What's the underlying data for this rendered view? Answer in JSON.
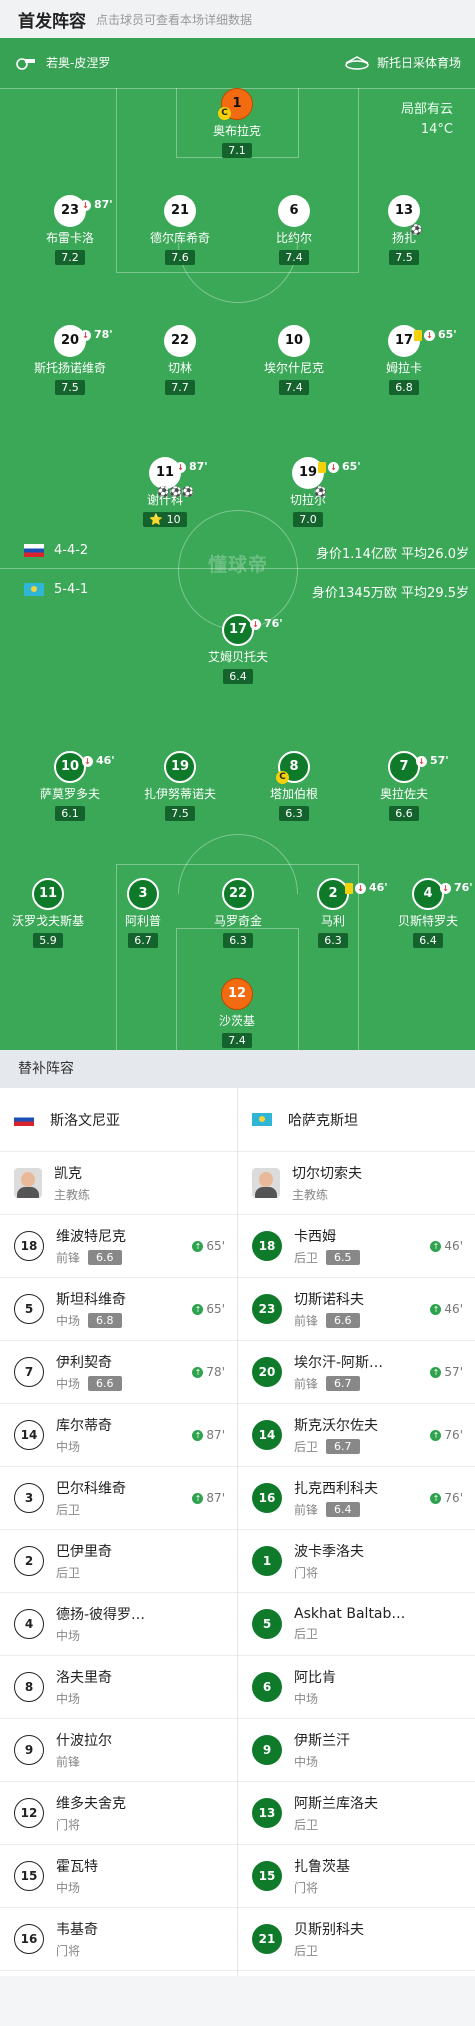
{
  "header": {
    "title": "首发阵容",
    "subtitle": "点击球员可查看本场详细数据"
  },
  "pitch": {
    "home_coach_label": "若奥-皮涅罗",
    "venue": "斯托日采体育场",
    "weather": "局部有云",
    "temperature": "14°C",
    "watermark": "懂球帝",
    "home_formation": "4-4-2",
    "away_formation": "5-4-1",
    "home_value": "身价1.14亿欧   平均26.0岁",
    "away_value": "身价1345万欧   平均29.5岁"
  },
  "home_players": [
    {
      "num": "1",
      "name": "奥布拉克",
      "rating": "7.1",
      "gk": true,
      "captain": true
    },
    {
      "num": "23",
      "name": "布雷卡洛",
      "rating": "7.2",
      "sub": "87'"
    },
    {
      "num": "21",
      "name": "德尔库希奇",
      "rating": "7.6"
    },
    {
      "num": "6",
      "name": "比约尔",
      "rating": "7.4"
    },
    {
      "num": "13",
      "name": "扬扎",
      "rating": "7.5"
    },
    {
      "num": "20",
      "name": "斯托扬诺维奇",
      "rating": "7.5",
      "sub": "78'"
    },
    {
      "num": "22",
      "name": "切林",
      "rating": "7.7"
    },
    {
      "num": "10",
      "name": "埃尔什尼克",
      "rating": "7.4"
    },
    {
      "num": "17",
      "name": "姆拉卡",
      "rating": "6.8",
      "sub": "65'",
      "yellow": true
    },
    {
      "num": "11",
      "name": "谢什科",
      "rating": "10",
      "sub": "87'"
    },
    {
      "num": "19",
      "name": "切拉尔",
      "rating": "7.0",
      "sub": "65'",
      "yellow": true
    }
  ],
  "away_players": [
    {
      "num": "17",
      "name": "艾姆贝托夫",
      "rating": "6.4",
      "sub": "76'"
    },
    {
      "num": "10",
      "name": "萨莫罗多夫",
      "rating": "6.1",
      "sub": "46'"
    },
    {
      "num": "19",
      "name": "扎伊努蒂诺夫",
      "rating": "7.5"
    },
    {
      "num": "8",
      "name": "塔加伯根",
      "rating": "6.3",
      "captain": true
    },
    {
      "num": "7",
      "name": "奥拉佐夫",
      "rating": "6.6",
      "sub": "57'"
    },
    {
      "num": "11",
      "name": "沃罗戈夫斯基",
      "rating": "5.9"
    },
    {
      "num": "3",
      "name": "阿利普",
      "rating": "6.7"
    },
    {
      "num": "22",
      "name": "马罗奇金",
      "rating": "6.3"
    },
    {
      "num": "2",
      "name": "马利",
      "rating": "6.3",
      "sub": "46'",
      "yellow": true
    },
    {
      "num": "4",
      "name": "贝斯特罗夫",
      "rating": "6.4",
      "sub": "76'"
    },
    {
      "num": "12",
      "name": "沙茨基",
      "rating": "7.4",
      "gk": true
    }
  ],
  "subs": {
    "title": "替补阵容",
    "home_team": "斯洛文尼亚",
    "away_team": "哈萨克斯坦",
    "home_coach": {
      "name": "凯克",
      "role": "主教练"
    },
    "away_coach": {
      "name": "切尔切索夫",
      "role": "主教练"
    },
    "home": [
      {
        "num": "18",
        "name": "维波特尼克",
        "pos": "前锋",
        "rating": "6.6",
        "time": "65'"
      },
      {
        "num": "5",
        "name": "斯坦科维奇",
        "pos": "中场",
        "rating": "6.8",
        "time": "65'"
      },
      {
        "num": "7",
        "name": "伊利契奇",
        "pos": "中场",
        "rating": "6.6",
        "time": "78'"
      },
      {
        "num": "14",
        "name": "库尔蒂奇",
        "pos": "中场",
        "rating": "",
        "time": "87'"
      },
      {
        "num": "3",
        "name": "巴尔科维奇",
        "pos": "后卫",
        "rating": "",
        "time": "87'"
      },
      {
        "num": "2",
        "name": "巴伊里奇",
        "pos": "后卫",
        "rating": "",
        "time": ""
      },
      {
        "num": "4",
        "name": "德扬-彼得罗…",
        "pos": "中场",
        "rating": "",
        "time": ""
      },
      {
        "num": "8",
        "name": "洛夫里奇",
        "pos": "中场",
        "rating": "",
        "time": ""
      },
      {
        "num": "9",
        "name": "什波拉尔",
        "pos": "前锋",
        "rating": "",
        "time": ""
      },
      {
        "num": "12",
        "name": "维多夫舍克",
        "pos": "门将",
        "rating": "",
        "time": ""
      },
      {
        "num": "15",
        "name": "霍瓦特",
        "pos": "中场",
        "rating": "",
        "time": ""
      },
      {
        "num": "16",
        "name": "韦基奇",
        "pos": "门将",
        "rating": "",
        "time": ""
      }
    ],
    "away": [
      {
        "num": "18",
        "name": "卡西姆",
        "pos": "后卫",
        "rating": "6.5",
        "time": "46'"
      },
      {
        "num": "23",
        "name": "切斯诺科夫",
        "pos": "前锋",
        "rating": "6.6",
        "time": "46'"
      },
      {
        "num": "20",
        "name": "埃尔汗-阿斯…",
        "pos": "前锋",
        "rating": "6.7",
        "time": "57'"
      },
      {
        "num": "14",
        "name": "斯克沃尔佐夫",
        "pos": "后卫",
        "rating": "6.7",
        "time": "76'"
      },
      {
        "num": "16",
        "name": "扎克西利科夫",
        "pos": "前锋",
        "rating": "6.4",
        "time": "76'"
      },
      {
        "num": "1",
        "name": "波卡季洛夫",
        "pos": "门将",
        "rating": "",
        "time": ""
      },
      {
        "num": "5",
        "name": "Askhat Baltab…",
        "pos": "后卫",
        "rating": "",
        "time": ""
      },
      {
        "num": "6",
        "name": "阿比肯",
        "pos": "中场",
        "rating": "",
        "time": ""
      },
      {
        "num": "9",
        "name": "伊斯兰汗",
        "pos": "中场",
        "rating": "",
        "time": ""
      },
      {
        "num": "13",
        "name": "阿斯兰库洛夫",
        "pos": "后卫",
        "rating": "",
        "time": ""
      },
      {
        "num": "15",
        "name": "扎鲁茨基",
        "pos": "门将",
        "rating": "",
        "time": ""
      },
      {
        "num": "21",
        "name": "贝斯别科夫",
        "pos": "后卫",
        "rating": "",
        "time": ""
      }
    ]
  }
}
